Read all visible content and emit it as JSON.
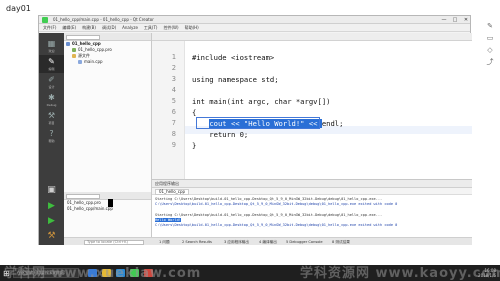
{
  "screen_label": "day01",
  "window": {
    "title": "01_hello_cpp/main.cpp - 01_hello_cpp - Qt Creator",
    "controls": [
      "—",
      "□",
      "✕"
    ]
  },
  "menu": [
    "文件(F)",
    "编辑(E)",
    "构建(B)",
    "调试(D)",
    "Analyze",
    "工具(T)",
    "控件(W)",
    "帮助(H)"
  ],
  "modes": [
    {
      "label": "欢迎",
      "icon": "grid-icon"
    },
    {
      "label": "编辑",
      "icon": "edit-icon"
    },
    {
      "label": "设计",
      "icon": "design-icon"
    },
    {
      "label": "Debug",
      "icon": "bug-icon"
    },
    {
      "label": "项目",
      "icon": "wrench-icon"
    },
    {
      "label": "帮助",
      "icon": "help-icon"
    }
  ],
  "project_tree": [
    {
      "label": "01_hello_cpp",
      "depth": 0
    },
    {
      "label": "01_hello_cpp.pro",
      "depth": 1
    },
    {
      "label": "源文件",
      "depth": 1
    },
    {
      "label": "main.cpp",
      "depth": 2
    }
  ],
  "open_documents": [
    "01_hello_cpp.pro",
    "01_hello_cpp/main.cpp"
  ],
  "editor": {
    "lines": [
      {
        "n": "1",
        "code": "#include <iostream>"
      },
      {
        "n": "2",
        "code": ""
      },
      {
        "n": "3",
        "code": "using namespace std;"
      },
      {
        "n": "4",
        "code": ""
      },
      {
        "n": "5",
        "code": "int main(int argc, char *argv[])"
      },
      {
        "n": "6",
        "code": "{"
      },
      {
        "n": "7",
        "code": "    cout << \"Hello World!\" << endl;"
      },
      {
        "n": "8",
        "code": "    return 0;"
      },
      {
        "n": "9",
        "code": "}"
      }
    ]
  },
  "output": {
    "header": "应用程序输出",
    "tab": "01_hello_cpp",
    "lines": [
      "Starting C:\\Users\\Desktop\\build-01_hello_cpp-Desktop_Qt_5_9_0_MinGW_32bit-Debug\\debug\\01_hello_cpp.exe...",
      "C:\\Users\\Desktop\\build-01_hello_cpp-Desktop_Qt_5_9_0_MinGW_32bit-Debug\\debug\\01_hello_cpp.exe exited with code 0",
      "",
      "Starting C:\\Users\\Desktop\\build-01_hello_cpp-Desktop_Qt_5_9_0_MinGW_32bit-Debug\\debug\\01_hello_cpp.exe...",
      "Hello World!",
      "C:\\Users\\Desktop\\build-01_hello_cpp-Desktop_Qt_5_9_0_MinGW_32bit-Debug\\debug\\01_hello_cpp.exe exited with code 0"
    ]
  },
  "statusbar": {
    "locator_placeholder": "Type to locate (Ctrl+K)",
    "items": [
      "1 问题",
      "2 Search Results",
      "3 应用程序输出",
      "4 编译输出",
      "5 Debugger Console",
      "8 测试结果"
    ]
  },
  "taskbar": {
    "search_placeholder": "在这里输入你要搜索的内容",
    "time": "16:08",
    "date": "2018/1/6"
  },
  "watermarks": [
    "学科网 www.xuekiaw.com",
    "学科资源网 www.kaoyy.com"
  ]
}
